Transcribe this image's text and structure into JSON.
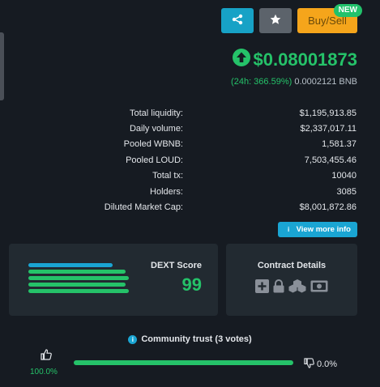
{
  "toolbar": {
    "share_icon": "share-icon",
    "star_icon": "star-icon",
    "buy_sell_label": "Buy/Sell",
    "new_badge": "NEW",
    "colors": {
      "share": "#17a2c6",
      "star": "#5c636b",
      "buysell": "#f5a51b",
      "badge": "#22c26b"
    }
  },
  "price": {
    "value": "$0.08001873",
    "icon": "arrow-up-circle-icon",
    "change_pct": "(24h: 366.59%)",
    "bnb_value": "0.0002121 BNB"
  },
  "stats": [
    {
      "label": "Total liquidity:",
      "value": "$1,195,913.85"
    },
    {
      "label": "Daily volume:",
      "value": "$2,337,017.11"
    },
    {
      "label": "Pooled WBNB:",
      "value": "1,581.37"
    },
    {
      "label": "Pooled LOUD:",
      "value": "7,503,455.46"
    },
    {
      "label": "Total tx:",
      "value": "10040"
    },
    {
      "label": "Holders:",
      "value": "3085"
    },
    {
      "label": "Diluted Market Cap:",
      "value": "$8,001,872.86"
    }
  ],
  "view_more": {
    "label": "View more info",
    "icon": "info-icon"
  },
  "dext_score": {
    "title": "DEXT Score",
    "value": "99"
  },
  "contract": {
    "title": "Contract Details",
    "icons": [
      "plus-square-icon",
      "lock-icon",
      "cubes-icon",
      "money-bill-icon"
    ]
  },
  "community": {
    "title": "Community trust (3 votes)",
    "up_pct": "100.0%",
    "down_pct": "0.0%",
    "up_fraction": 1.0
  },
  "colors": {
    "accent_green": "#25c269",
    "accent_blue": "#1aa5d3",
    "background": "#161b22",
    "card": "#222a31"
  }
}
